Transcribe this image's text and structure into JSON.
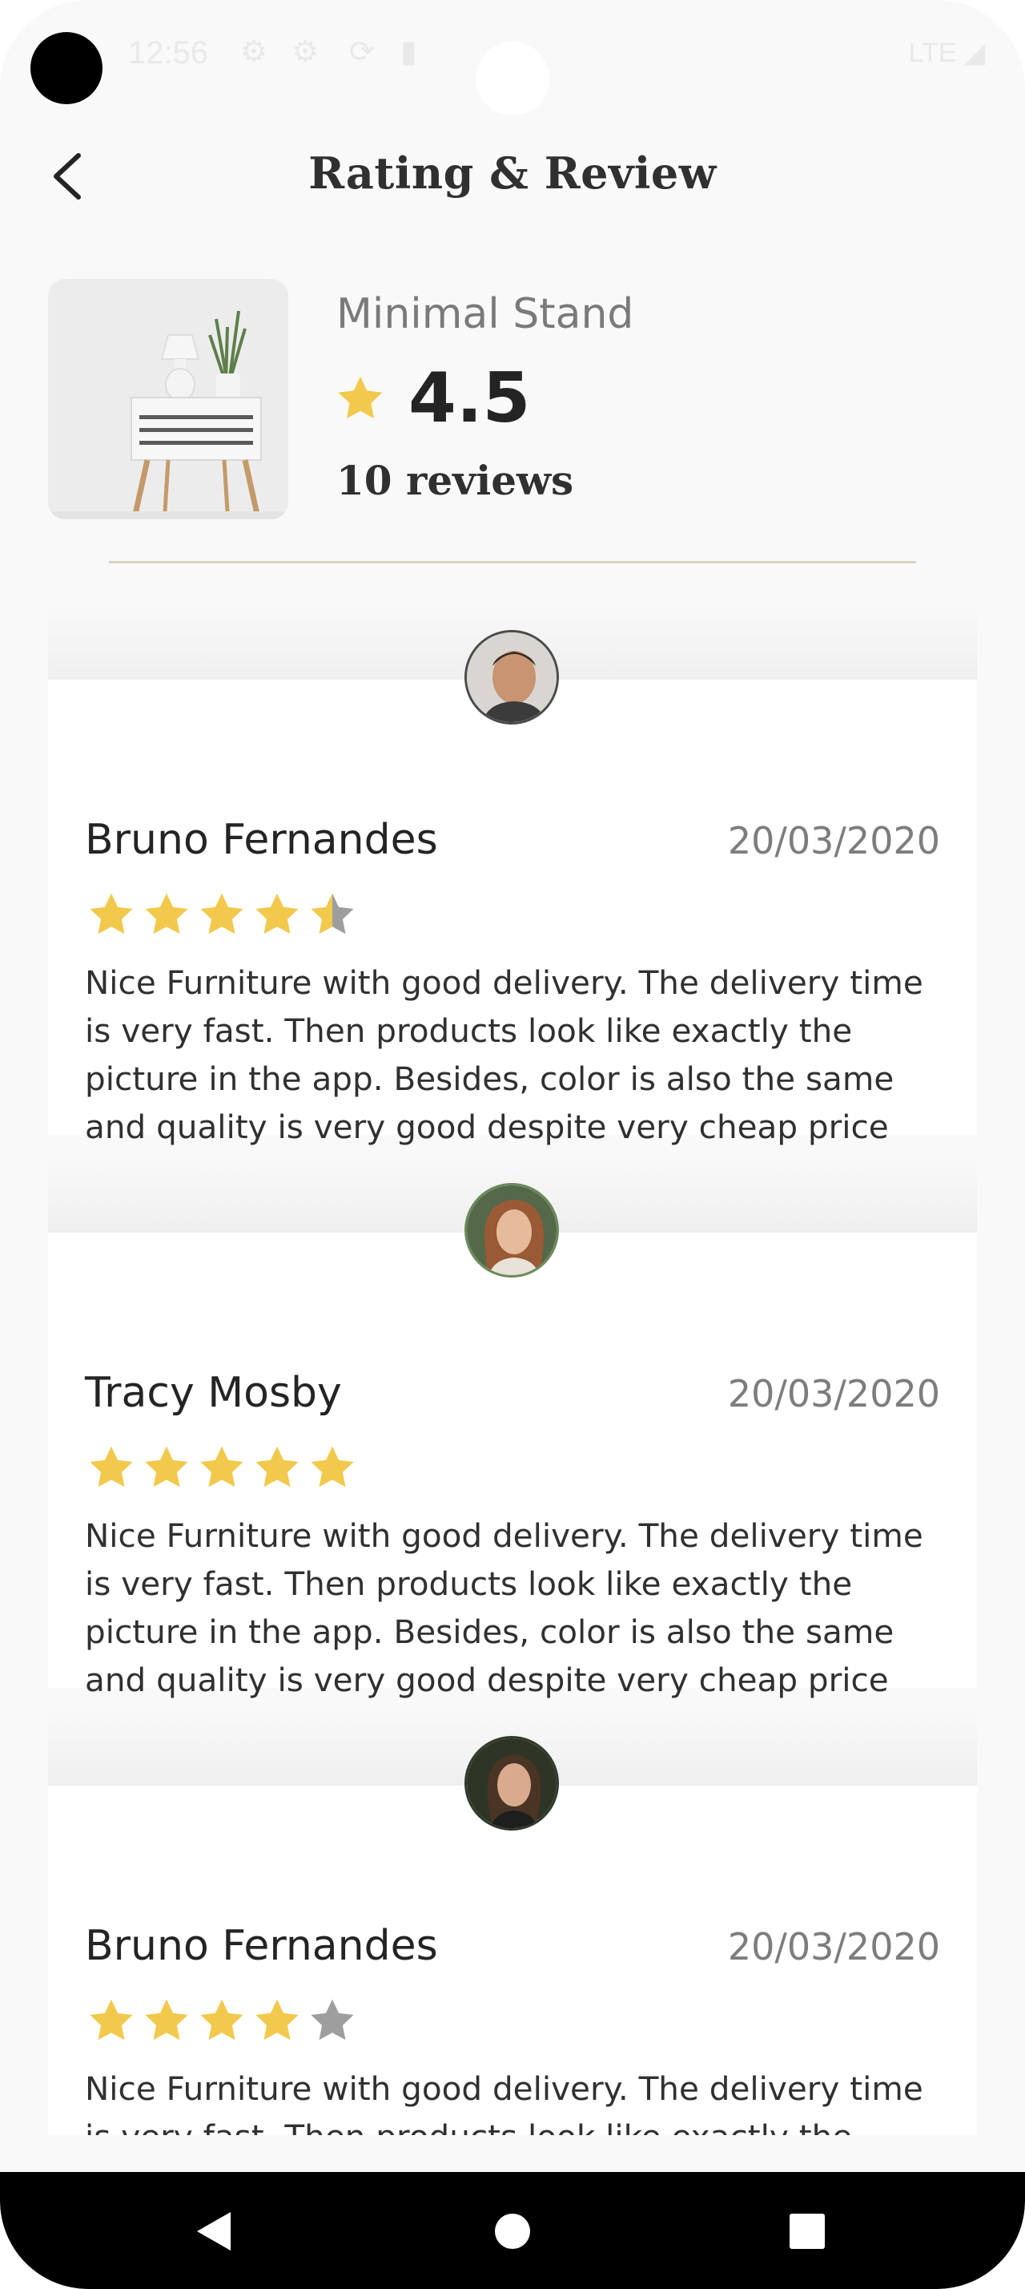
{
  "status_bar": {
    "time": "12:56",
    "network": "LTE"
  },
  "header": {
    "title": "Rating & Review"
  },
  "product": {
    "name": "Minimal Stand",
    "rating": "4.5",
    "reviews_label": "10 reviews"
  },
  "colors": {
    "star_filled": "#F2C94C",
    "star_empty": "#9E9E9E",
    "divider": "#DCD0C4"
  },
  "reviews": [
    {
      "name": "Bruno Fernandes",
      "date": "20/03/2020",
      "rating": 4.5,
      "text": "Nice Furniture with good delivery. The delivery time is very fast. Then products look like exactly the picture in the app. Besides, color is also the same and quality is very good despite very cheap price"
    },
    {
      "name": "Tracy Mosby",
      "date": "20/03/2020",
      "rating": 5,
      "text": "Nice Furniture with good delivery. The delivery time is very fast. Then products look like exactly the picture in the app. Besides, color is also the same and quality is very good despite very cheap price"
    },
    {
      "name": "Bruno Fernandes",
      "date": "20/03/2020",
      "rating": 4,
      "text": "Nice Furniture with good delivery. The delivery time is very fast. Then products look like exactly the picture in the app. Besides, color is also the same and quality is very good despite very cheap price"
    }
  ],
  "nav": {
    "back_icon": "triangle-back-icon",
    "home_icon": "circle-home-icon",
    "recents_icon": "square-recents-icon"
  }
}
